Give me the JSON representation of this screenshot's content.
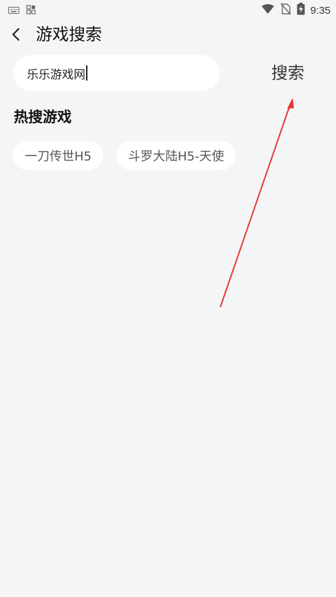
{
  "status_bar": {
    "time": "9:35",
    "icons_left": [
      "keyboard-icon",
      "grid-icon"
    ],
    "icons_right": [
      "wifi-icon",
      "no-sim-icon",
      "battery-charging-icon"
    ]
  },
  "header": {
    "title": "游戏搜索",
    "back_icon": "chevron-left-icon"
  },
  "search": {
    "value": "乐乐游戏网",
    "button_label": "搜索"
  },
  "hot": {
    "title": "热搜游戏",
    "tags": [
      "一刀传世H5",
      "斗罗大陆H5-天使"
    ]
  },
  "colors": {
    "background": "#f4f5f7",
    "chip_background": "#ffffff",
    "annotation_arrow": "#e53935"
  }
}
